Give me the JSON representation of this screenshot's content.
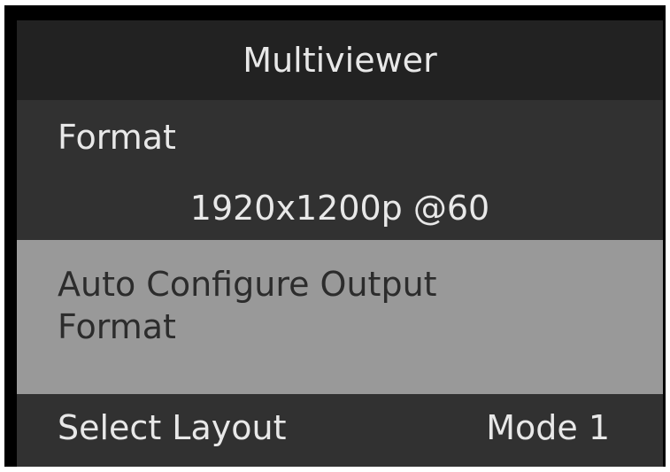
{
  "header": {
    "title": "Multiviewer"
  },
  "format": {
    "label": "Format",
    "value": "1920x1200p @60"
  },
  "auto_configure": {
    "label": "Auto Configure Output Format"
  },
  "layout": {
    "label": "Select Layout",
    "value": "Mode 1"
  },
  "colors": {
    "header_bg": "#222222",
    "panel_bg": "#313131",
    "selected_bg": "#999999",
    "text_light": "#e8e8e8",
    "text_dark": "#2c2c2c"
  }
}
